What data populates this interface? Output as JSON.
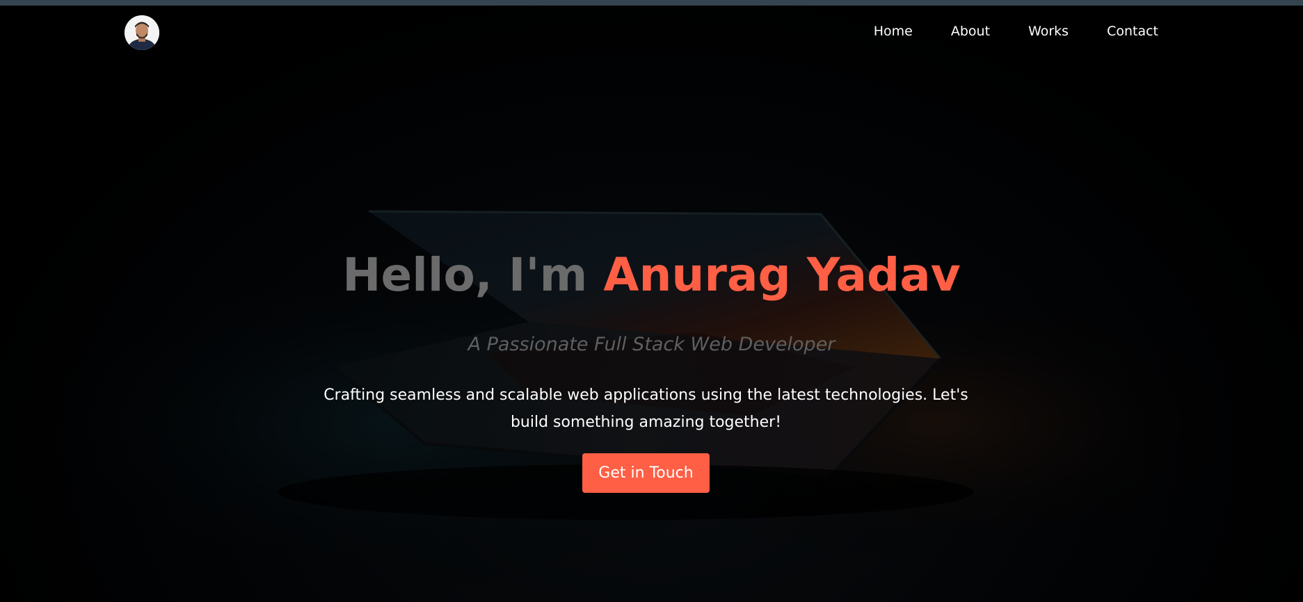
{
  "nav": {
    "avatar_alt": "Profile photo",
    "links": [
      {
        "label": "Home"
      },
      {
        "label": "About"
      },
      {
        "label": "Works"
      },
      {
        "label": "Contact"
      }
    ]
  },
  "hero": {
    "greeting": "Hello, I'm ",
    "name": "Anurag Yadav",
    "subtitle": "A Passionate Full Stack Web Developer",
    "description": "Crafting seamless and scalable web applications using the latest technologies. Let's build something amazing together!",
    "cta_label": "Get in Touch"
  },
  "colors": {
    "accent": "#ff5f45",
    "background": "#000000",
    "topbar": "#34454f",
    "muted_heading": "#6b6b6b",
    "muted_subtitle": "#5f5f5f"
  },
  "icons": {
    "avatar": "profile-photo"
  }
}
